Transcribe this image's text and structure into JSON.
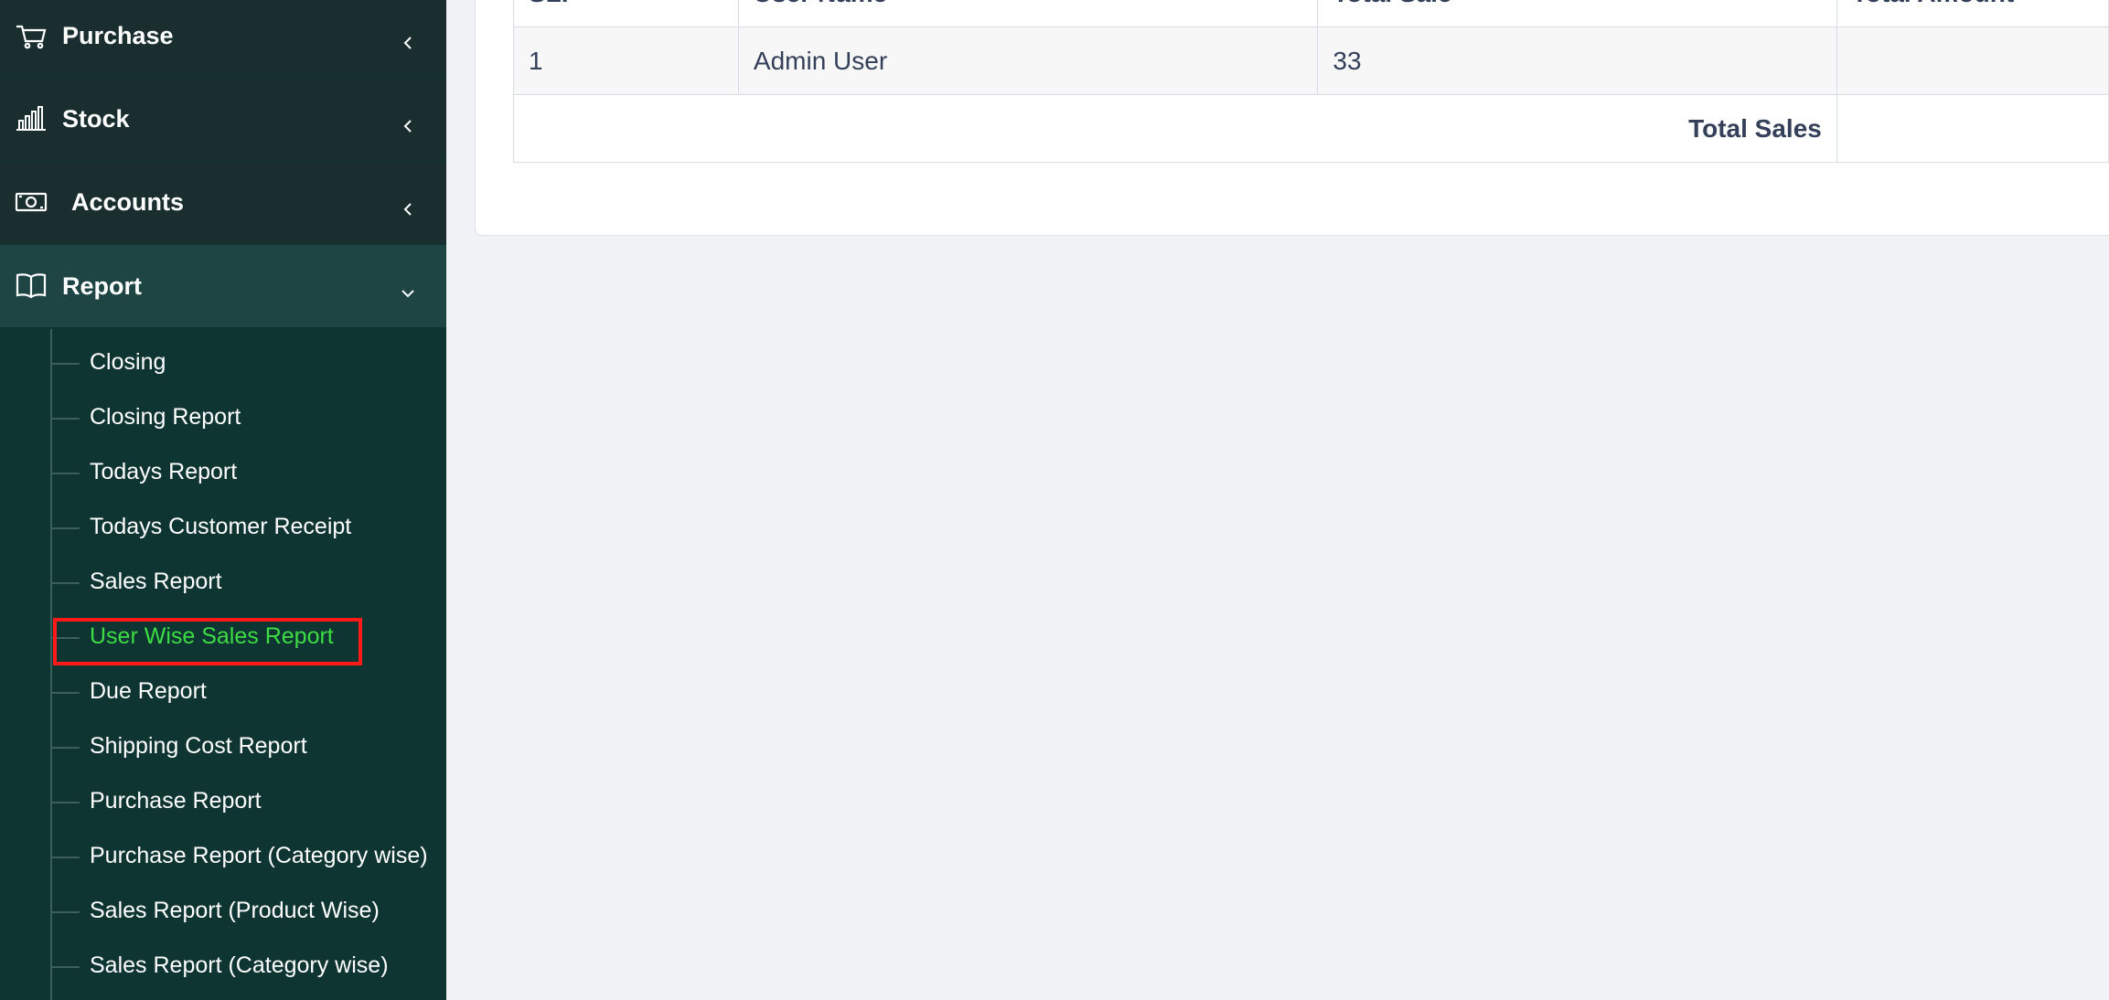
{
  "sidebar": {
    "top_items": [
      {
        "label": "Purchase",
        "icon": "cart-icon"
      },
      {
        "label": "Stock",
        "icon": "bar-chart-icon"
      },
      {
        "label": "Accounts",
        "icon": "money-icon"
      },
      {
        "label": "Report",
        "icon": "book-icon",
        "expanded": true
      }
    ],
    "report_items": [
      "Closing",
      "Closing Report",
      "Todays Report",
      "Todays Customer Receipt",
      "Sales Report",
      "User Wise Sales Report",
      "Due Report",
      "Shipping Cost Report",
      "Purchase Report",
      "Purchase Report (Category wise)",
      "Sales Report (Product Wise)",
      "Sales Report (Category wise)"
    ],
    "selected_item": "User Wise Sales Report"
  },
  "table": {
    "headers": [
      "SL.",
      "User Name",
      "Total Sale",
      "Total Amount"
    ],
    "rows": [
      {
        "sl": "1",
        "user": "Admin User",
        "sale": "33",
        "amount": ""
      }
    ],
    "footer_label": "Total Sales",
    "footer_value": ""
  },
  "colors": {
    "sidebar_bg": "#0f3533",
    "sidebar_top_bg": "#1b2e2f",
    "active_bg": "#1e4543",
    "selected_text": "#3ddc43",
    "highlight_border": "#ff1a1a",
    "content_bg": "#f0f2f6",
    "table_text": "#34405a"
  }
}
